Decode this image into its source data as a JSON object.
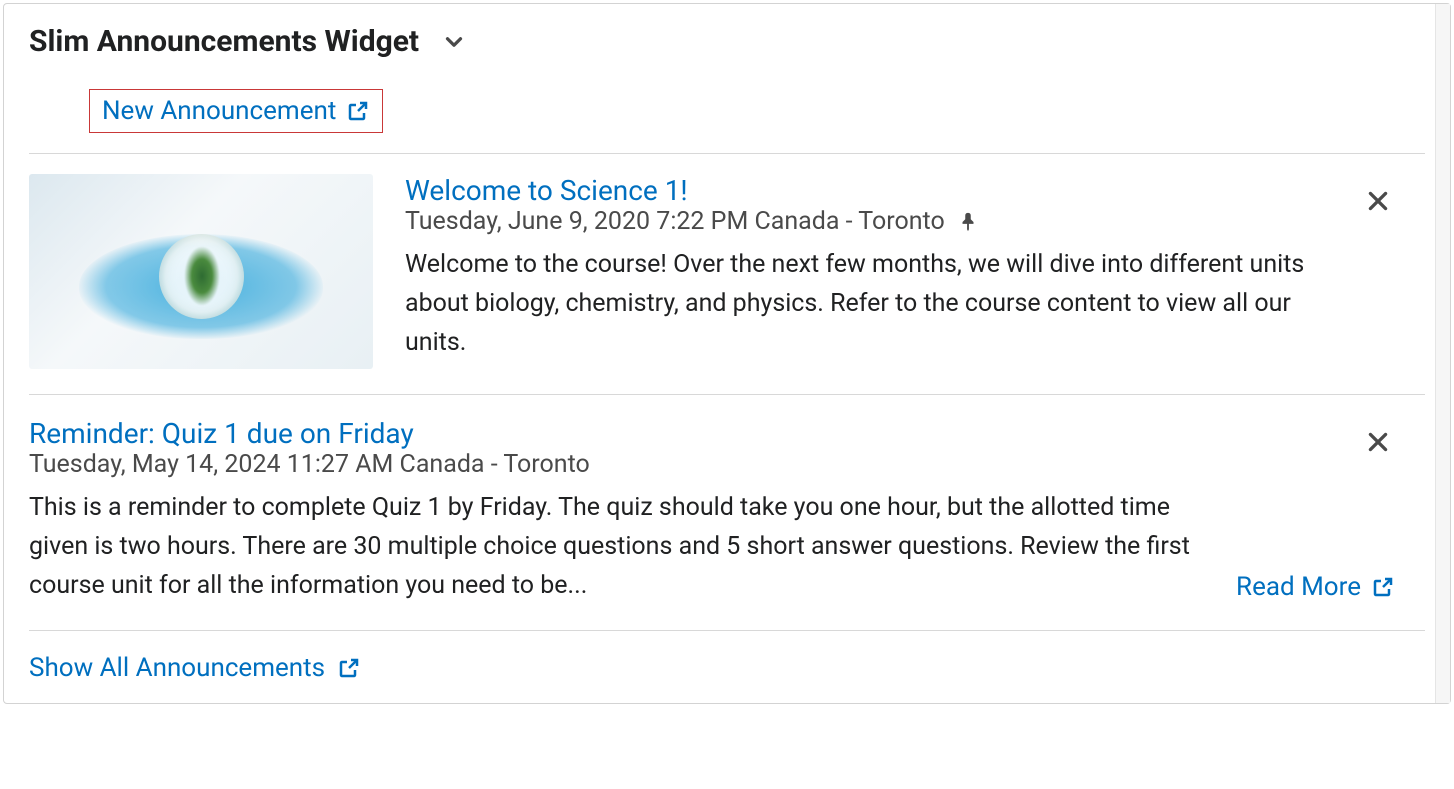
{
  "widget": {
    "title": "Slim Announcements Widget",
    "new_announcement_label": "New Announcement",
    "show_all_label": "Show All Announcements",
    "read_more_label": "Read More"
  },
  "colors": {
    "link": "#006fbf",
    "highlight_border": "#c93838",
    "text": "#202122",
    "muted": "#4a4a4a"
  },
  "announcements": [
    {
      "title": "Welcome to Science 1!",
      "date": "Tuesday, June 9, 2020 7:22 PM Canada - Toronto",
      "pinned": true,
      "has_thumbnail": true,
      "body": "Welcome to the course! Over the next few months, we will dive into different units about biology, chemistry, and physics. Refer to the course content to view all our units."
    },
    {
      "title": "Reminder: Quiz 1 due on Friday",
      "date": "Tuesday, May 14, 2024 11:27 AM Canada - Toronto",
      "pinned": false,
      "has_thumbnail": false,
      "body": "This is a reminder to complete Quiz 1 by Friday. The quiz should take you one hour, but the allotted time given is two hours. There are 30 multiple choice questions and 5 short answer questions. Review the first course unit for all the information you need to be...",
      "truncated": true
    }
  ]
}
